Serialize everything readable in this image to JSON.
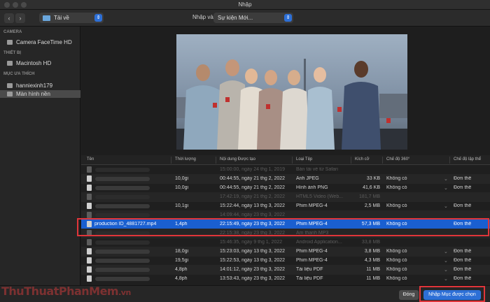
{
  "window": {
    "title": "Nhập"
  },
  "toolbar": {
    "folder": "Tải về",
    "import_label": "Nhập vào:",
    "import_target": "Sự kiện Mới..."
  },
  "sidebar": {
    "sections": [
      {
        "heading": "CAMERA",
        "items": [
          {
            "label": "Camera FaceTime HD",
            "icon": "camera-icon"
          }
        ]
      },
      {
        "heading": "THIẾT BỊ",
        "items": [
          {
            "label": "Macintosh HD",
            "icon": "disk-icon"
          }
        ]
      },
      {
        "heading": "MỤC ƯA THÍCH",
        "items": [
          {
            "label": "hanniexinh179",
            "icon": "home-icon"
          },
          {
            "label": "Màn hình nền",
            "icon": "desktop-icon",
            "selected": true
          }
        ]
      }
    ]
  },
  "table": {
    "columns": [
      "Tên",
      "Thời lượng",
      "Nội dung Được tạo",
      "Loại Tệp",
      "Kích cỡ",
      "Chế độ 360°",
      "Chế độ lập thể"
    ],
    "rows": [
      {
        "name": "",
        "duration": "",
        "created": "15:00:00, ngày 24 thg 1, 2019",
        "type": "Bản tải về từ Safari",
        "size": "",
        "mode360": "",
        "stereo": "",
        "dim": true
      },
      {
        "name": "",
        "duration": "10,0gi",
        "created": "00:44:55, ngày 21 thg 2, 2022",
        "type": "Ảnh JPEG",
        "size": "33 KB",
        "mode360": "Không có",
        "stereo": "Đơn thể"
      },
      {
        "name": "",
        "duration": "10,0gi",
        "created": "00:44:55, ngày 21 thg 2, 2022",
        "type": "Hình ảnh PNG",
        "size": "41,6 KB",
        "mode360": "Không có",
        "stereo": "Đơn thể"
      },
      {
        "name": "",
        "duration": "",
        "created": "17:42:19, ngày 21 thg 2, 2022",
        "type": "HTML5 Video (Web...",
        "size": "181,7 MB",
        "mode360": "",
        "stereo": "",
        "dim": true
      },
      {
        "name": "",
        "duration": "10,1gi",
        "created": "15:22:44, ngày 13 thg 3, 2022",
        "type": "Phim MPEG-4",
        "size": "2,5 MB",
        "mode360": "Không có",
        "stereo": "Đơn thể"
      },
      {
        "name": "",
        "duration": "",
        "created": "14:09:44, ngày 23 thg 3, 2022",
        "type": "",
        "size": "",
        "mode360": "",
        "stereo": "",
        "dim": true
      },
      {
        "name": "production ID_4881727.mp4",
        "duration": "1,4ph",
        "created": "22:15:49, ngày 23 thg 3, 2022",
        "type": "Phim MPEG-4",
        "size": "57,3 MB",
        "mode360": "Không có",
        "stereo": "Đơn thể",
        "selected": true
      },
      {
        "name": "",
        "duration": "",
        "created": "22:15:38, ngày 23 thg 3, 2022",
        "type": "Âm thanh MP3",
        "size": "",
        "mode360": "",
        "stereo": "",
        "dim": true
      },
      {
        "name": "",
        "duration": "",
        "created": "15:46:35, ngày 9 thg 1, 2022",
        "type": "Android Application...",
        "size": "33,8 MB",
        "mode360": "",
        "stereo": "",
        "dim": true
      },
      {
        "name": "",
        "duration": "18,0gi",
        "created": "15:23:03, ngày 13 thg 3, 2022",
        "type": "Phim MPEG-4",
        "size": "3,8 MB",
        "mode360": "Không có",
        "stereo": "Đơn thể"
      },
      {
        "name": "",
        "duration": "19,5gi",
        "created": "15:22:53, ngày 13 thg 3, 2022",
        "type": "Phim MPEG-4",
        "size": "4,3 MB",
        "mode360": "Không có",
        "stereo": "Đơn thể"
      },
      {
        "name": "",
        "duration": "4,8ph",
        "created": "14:01:12, ngày 23 thg 3, 2022",
        "type": "Tài liệu PDF",
        "size": "11 MB",
        "mode360": "Không có",
        "stereo": "Đơn thể"
      },
      {
        "name": "",
        "duration": "4,8ph",
        "created": "13:53:43, ngày 23 thg 3, 2022",
        "type": "Tài liệu PDF",
        "size": "11 MB",
        "mode360": "Không có",
        "stereo": "Đơn thể"
      }
    ]
  },
  "footer": {
    "close_label": "Đóng",
    "import_label": "Nhập Mục được chọn"
  },
  "watermark": {
    "main": "ThuThuatPhanMem",
    "suffix": ".vn"
  },
  "colors": {
    "accent": "#2d6fd6",
    "selection": "#1a5fd0",
    "highlight": "#e0353a"
  }
}
